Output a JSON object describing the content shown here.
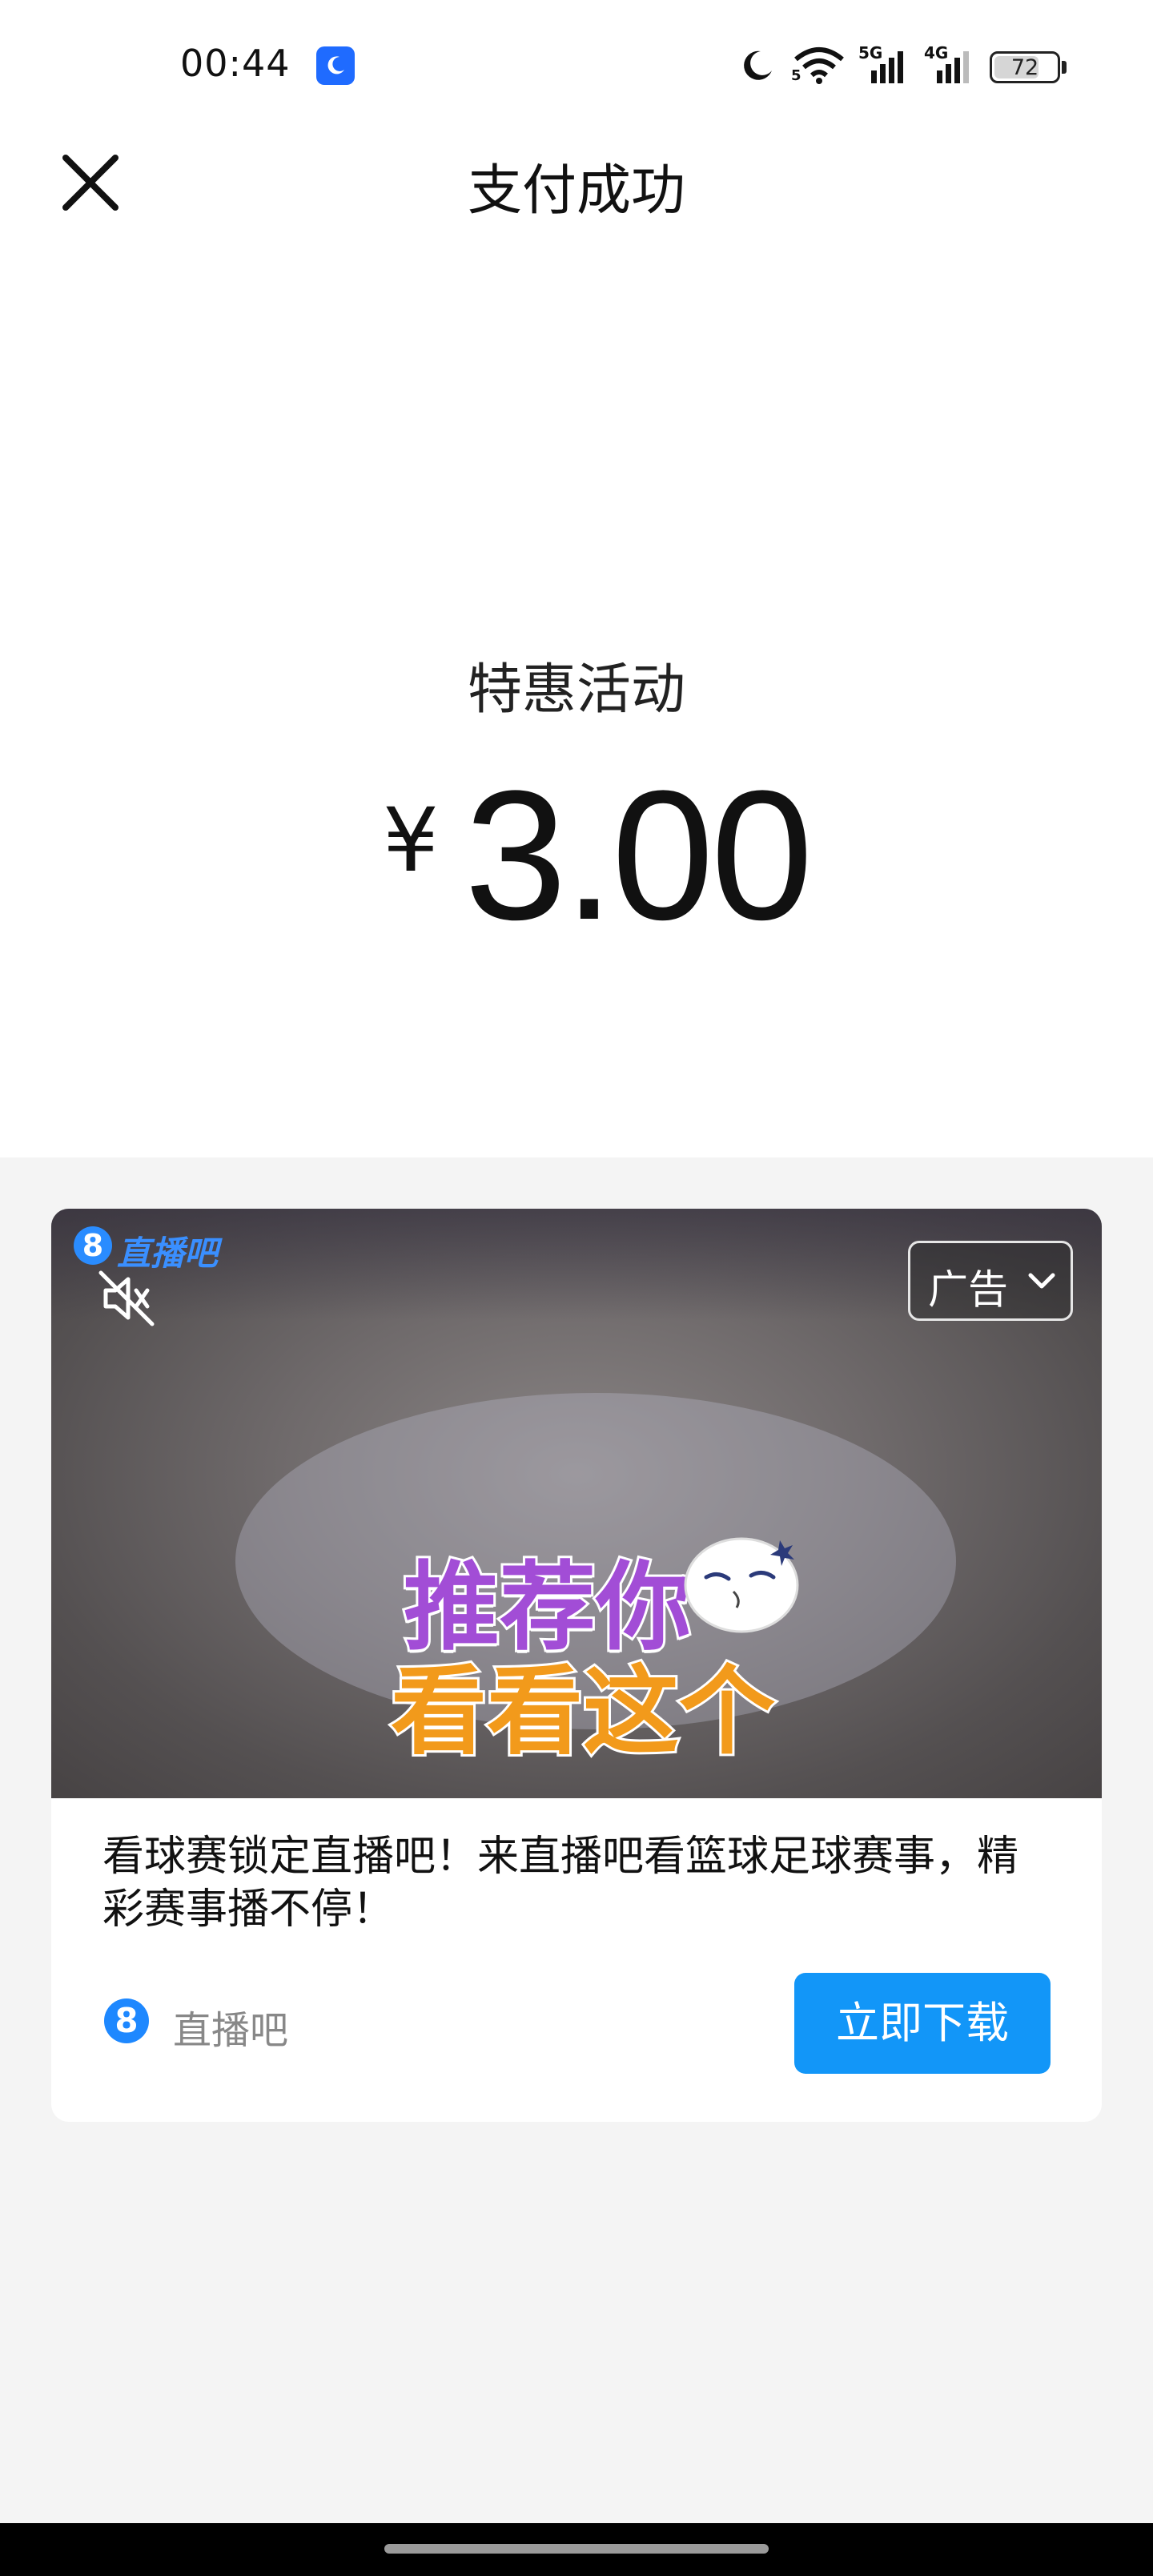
{
  "status_bar": {
    "time": "00:44",
    "network_5g_label": "5G",
    "network_4g_label": "4G",
    "wifi_sub_label": "5",
    "battery_level": 72,
    "battery_text": "72",
    "icons": [
      "moon-app-icon",
      "do-not-disturb-moon-icon",
      "wifi-icon",
      "signal-5g-icon",
      "signal-4g-icon",
      "battery-icon"
    ]
  },
  "header": {
    "title": "支付成功",
    "close_icon": "close-icon"
  },
  "payment": {
    "label": "特惠活动",
    "currency_symbol": "¥",
    "amount": "3.00"
  },
  "ad": {
    "watermark_logo": "8",
    "watermark_text": "直播吧",
    "tag_label": "广告",
    "overlay_line1": "推荐你",
    "overlay_line2": "看看这个",
    "description": "看球赛锁定直播吧！来直播吧看篮球足球赛事，精彩赛事播不停！",
    "advertiser_logo": "8",
    "advertiser_name": "直播吧",
    "cta_label": "立即下载",
    "colors": {
      "cta": "#1296f8",
      "brand": "#1e88ff"
    }
  }
}
